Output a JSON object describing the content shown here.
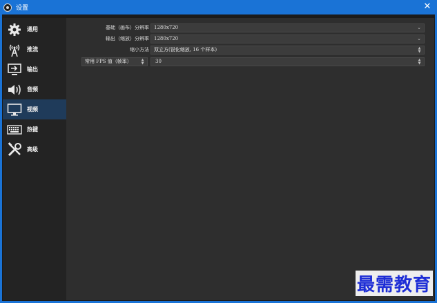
{
  "window": {
    "title": "设置",
    "close_glyph": "✕"
  },
  "sidebar": {
    "items": [
      {
        "label": "通用",
        "icon": "gear-icon",
        "active": false
      },
      {
        "label": "推流",
        "icon": "broadcast-icon",
        "active": false
      },
      {
        "label": "输出",
        "icon": "output-icon",
        "active": false
      },
      {
        "label": "音频",
        "icon": "speaker-icon",
        "active": false
      },
      {
        "label": "视频",
        "icon": "monitor-icon",
        "active": true
      },
      {
        "label": "热键",
        "icon": "keyboard-icon",
        "active": false
      },
      {
        "label": "高级",
        "icon": "tools-icon",
        "active": false
      }
    ]
  },
  "video": {
    "base_resolution": {
      "label": "基础（画布）分辨率",
      "value": "1280x720"
    },
    "output_resolution": {
      "label": "输出（缩放）分辨率",
      "value": "1280x720"
    },
    "downscale_filter": {
      "label": "缩小方法",
      "value": "双立方(锐化缩放, 16 个样本)"
    },
    "fps": {
      "type_label": "常用 FPS 值（帧率）",
      "value": "30"
    }
  },
  "watermark": "最需教育",
  "colors": {
    "accent": "#1a73d6",
    "active_item": "#1f3b5a",
    "watermark": "#1e2ed6"
  }
}
